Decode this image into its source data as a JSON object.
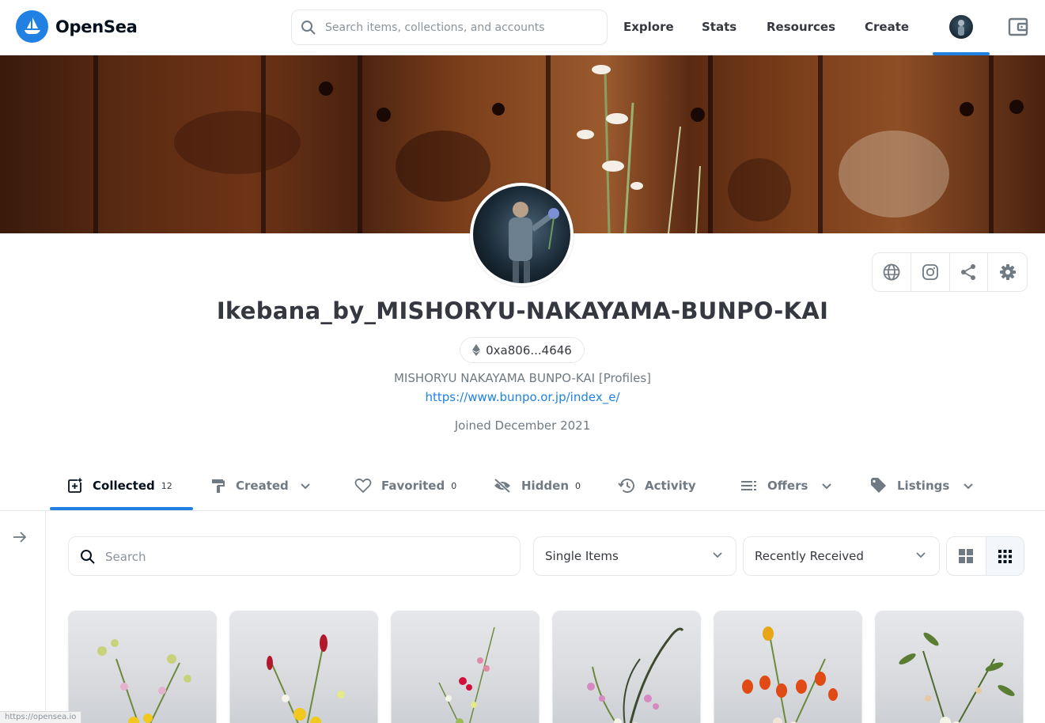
{
  "app": {
    "name": "OpenSea",
    "brand_color": "#2081e2"
  },
  "header": {
    "search_placeholder": "Search items, collections, and accounts",
    "nav": {
      "explore": "Explore",
      "stats": "Stats",
      "resources": "Resources",
      "create": "Create"
    }
  },
  "profile": {
    "name": "Ikebana_by_MISHORYU-NAKAYAMA-BUNPO-KAI",
    "address": "0xa806...4646",
    "bio": "MISHORYU NAKAYAMA BUNPO-KAI [Profiles]",
    "website": "https://www.bunpo.or.jp/index_e/",
    "joined": "Joined December 2021",
    "actions": [
      "globe-icon",
      "instagram-icon",
      "share-icon",
      "settings-icon"
    ]
  },
  "tabs": {
    "collected": {
      "label": "Collected",
      "count": "12"
    },
    "created": {
      "label": "Created"
    },
    "favorited": {
      "label": "Favorited",
      "count": "0"
    },
    "hidden": {
      "label": "Hidden",
      "count": "0"
    },
    "activity": {
      "label": "Activity"
    },
    "offers": {
      "label": "Offers"
    },
    "listings": {
      "label": "Listings"
    }
  },
  "filters": {
    "search_placeholder": "Search",
    "item_type": "Single Items",
    "sort": "Recently Received"
  },
  "status_bar": {
    "url": "https://opensea.io"
  }
}
